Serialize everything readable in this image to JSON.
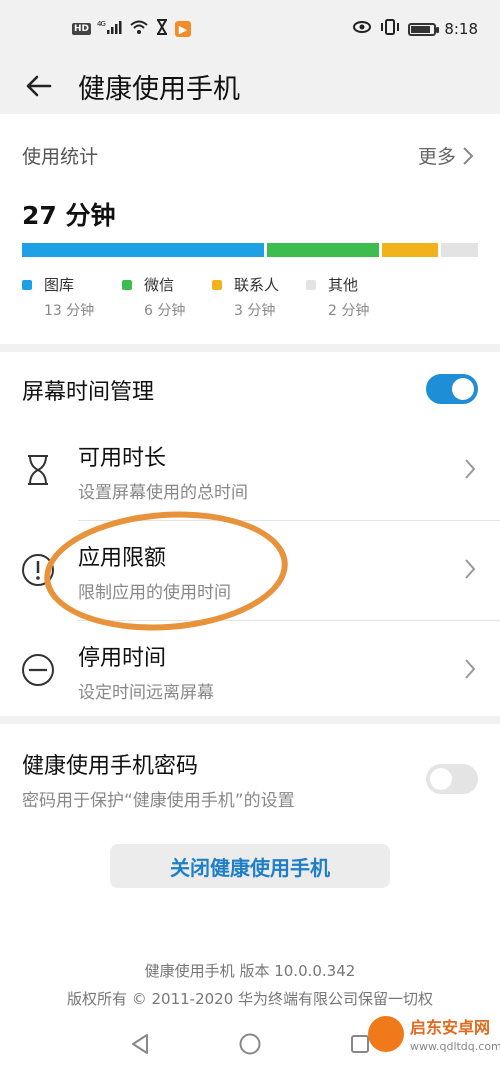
{
  "status_bar": {
    "left_icons": [
      "hd-badge",
      "4g-signal-icon",
      "wifi-icon",
      "hourglass-icon",
      "app-notification-icon"
    ],
    "hd_label": "HD",
    "signal_label": "4G",
    "right_icons": [
      "eye-icon",
      "vibrate-icon",
      "battery-icon"
    ],
    "time": "8:18",
    "battery_level": 0.85
  },
  "header": {
    "title": "健康使用手机",
    "back_icon": "arrow-left-icon"
  },
  "usage": {
    "section_title": "使用统计",
    "more_label": "更多",
    "total": "27 分钟",
    "bar_colors": {
      "gallery": "#1ea0e4",
      "wechat": "#3dbd4f",
      "contacts": "#f2b21b",
      "other": "#e3e3e3"
    },
    "bar_minutes": {
      "gallery": 13,
      "wechat": 6,
      "contacts": 3,
      "other": 2
    },
    "legend": [
      {
        "name": "图库",
        "value": "13 分钟",
        "color": "#1ea0e4"
      },
      {
        "name": "微信",
        "value": "6 分钟",
        "color": "#3dbd4f"
      },
      {
        "name": "联系人",
        "value": "3 分钟",
        "color": "#f2b21b"
      },
      {
        "name": "其他",
        "value": "2 分钟",
        "color": "#e3e3e3"
      }
    ]
  },
  "screen_time": {
    "title": "屏幕时间管理",
    "toggle_on": true,
    "items": [
      {
        "name": "可用时长",
        "desc": "设置屏幕使用的总时间",
        "icon": "hourglass-icon"
      },
      {
        "name": "应用限额",
        "desc": "限制应用的使用时间",
        "icon": "alert-circle-icon"
      },
      {
        "name": "停用时间",
        "desc": "设定时间远离屏幕",
        "icon": "minus-circle-icon"
      }
    ]
  },
  "password": {
    "title": "健康使用手机密码",
    "desc": "密码用于保护“健康使用手机”的设置",
    "toggle_on": false
  },
  "close_button": "关闭健康使用手机",
  "footer": {
    "version": "健康使用手机 版本 10.0.0.342",
    "copyright": "版权所有 © 2011-2020 华为终端有限公司保留一切权"
  },
  "navbar": {
    "icons": [
      "back-triangle-icon",
      "home-circle-icon",
      "recents-square-icon"
    ]
  },
  "watermark": {
    "text": "启东安卓网",
    "url": "www.qdltdq.com"
  },
  "colors": {
    "accent": "#1e8fd6",
    "annotation": "#e8923c"
  }
}
